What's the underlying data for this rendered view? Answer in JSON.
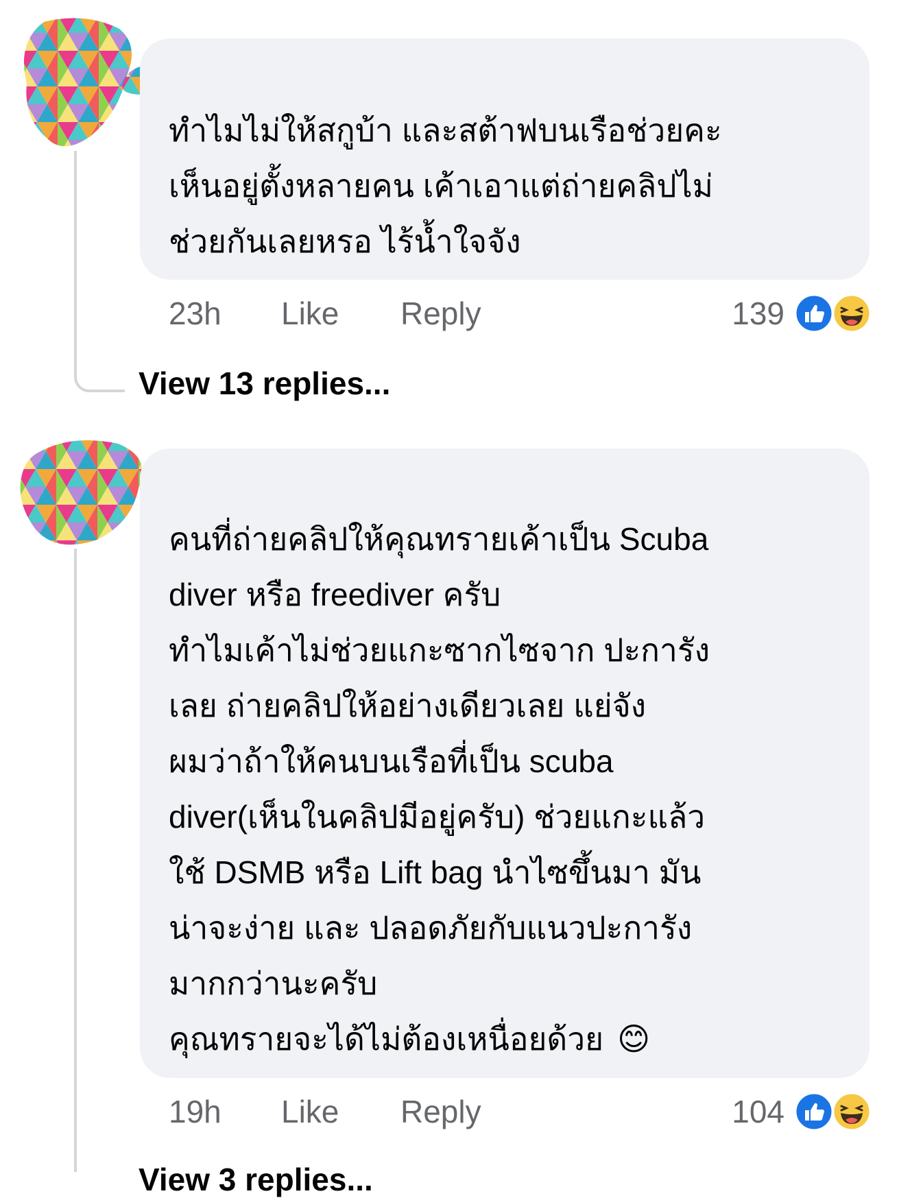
{
  "comments": [
    {
      "author": "",
      "text": "ทำไมไม่ให้สกูบ้า และสต้าฟบนเรือช่วยคะ\nเห็นอยู่ตั้งหลายคน เค้าเอาแต่ถ่ายคลิปไม่\nช่วยกันเลยหรอ ไร้น้ำใจจัง",
      "time": "23h",
      "like_label": "Like",
      "reply_label": "Reply",
      "reaction_count": "139",
      "reactions": [
        "like-icon",
        "haha-icon"
      ],
      "view_replies": "View 13 replies..."
    },
    {
      "author": "",
      "text": "คนที่ถ่ายคลิปให้คุณทรายเค้าเป็น Scuba\ndiver หรือ freediver ครับ\nทำไมเค้าไม่ช่วยแกะซากไซจาก ปะการัง\nเลย ถ่ายคลิปให้อย่างเดียวเลย แย่จัง\nผมว่าถ้าให้คนบนเรือที่เป็น scuba\ndiver(เห็นในคลิปมีอยู่ครับ) ช่วยแกะแล้ว\nใช้ DSMB หรือ Lift bag นำไซขึ้นมา มัน\nน่าจะง่าย และ ปลอดภัยกับแนวปะการัง\nมากกว่านะครับ\nคุณทรายจะได้ไม่ต้องเหนื่อยด้วย",
      "emoji": "😊",
      "time": "19h",
      "like_label": "Like",
      "reply_label": "Reply",
      "reaction_count": "104",
      "reactions": [
        "like-icon",
        "haha-icon"
      ],
      "view_replies": "View 3 replies..."
    }
  ],
  "colors": {
    "bubble": "#f0f2f5",
    "meta": "#65676b",
    "like_blue": "#1b74e4",
    "haha_yellow": "#f7c843",
    "thread_line": "#d4d6da"
  }
}
